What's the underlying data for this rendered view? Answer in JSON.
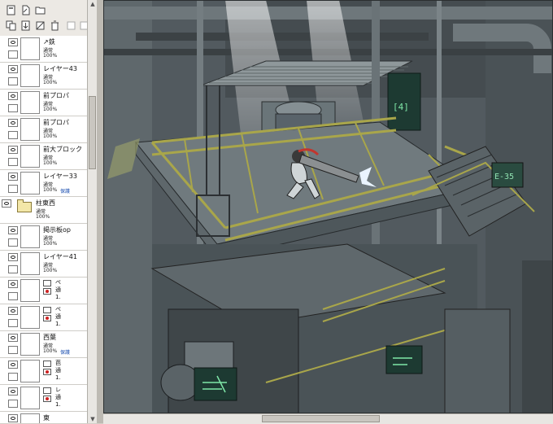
{
  "toolbar": {
    "icons": [
      "new-layer-icon",
      "new-linework-icon",
      "new-folder-icon",
      "copy-layer-icon",
      "merge-layer-icon",
      "clear-layer-icon",
      "delete-layer-icon",
      "transfer-down-icon",
      "merge-down-icon"
    ]
  },
  "layers": [
    {
      "name": "↗鉄",
      "mode": "通常",
      "opacity": "100%",
      "protect": "",
      "type": "layer"
    },
    {
      "name": "レイヤー43",
      "mode": "通常",
      "opacity": "100%",
      "protect": "",
      "type": "layer"
    },
    {
      "name": "前プロパ",
      "mode": "通常",
      "opacity": "100%",
      "protect": "",
      "type": "layer"
    },
    {
      "name": "前プロパ",
      "mode": "通常",
      "opacity": "100%",
      "protect": "",
      "type": "layer"
    },
    {
      "name": "前大ブロック",
      "mode": "通常",
      "opacity": "100%",
      "protect": "",
      "type": "layer"
    },
    {
      "name": "レイヤー33",
      "mode": "通常",
      "opacity": "100%",
      "protect": "保護",
      "type": "layer"
    },
    {
      "name": "柱東西",
      "mode": "通常",
      "opacity": "100%",
      "protect": "",
      "type": "folder"
    },
    {
      "name": "掲示板op",
      "mode": "通常",
      "opacity": "100%",
      "protect": "",
      "type": "layer"
    },
    {
      "name": "レイヤー41",
      "mode": "通常",
      "opacity": "100%",
      "protect": "",
      "type": "layer"
    },
    {
      "name": "ペ 通 1.",
      "mode": "",
      "opacity": "",
      "protect": "",
      "type": "clip"
    },
    {
      "name": "ペ 通 1.",
      "mode": "",
      "opacity": "",
      "protect": "",
      "type": "clip"
    },
    {
      "name": "西葉",
      "mode": "通常",
      "opacity": "100%",
      "protect": "保護",
      "type": "layer"
    },
    {
      "name": "芭 通 1.",
      "mode": "",
      "opacity": "",
      "protect": "",
      "type": "clip"
    },
    {
      "name": "レ 通 1.",
      "mode": "",
      "opacity": "",
      "protect": "",
      "type": "clip"
    },
    {
      "name": "東",
      "mode": "",
      "opacity": "",
      "protect": "",
      "type": "layer"
    }
  ],
  "canvas": {
    "sign_left": "[4]",
    "sign_right": "E-35",
    "palette": {
      "bg": "#525a5f",
      "metal": "#7a8488",
      "rail": "#a9a64a",
      "light": "#d8e2e4",
      "screen": "#1d3a32",
      "glow": "#7fe8a8"
    }
  }
}
